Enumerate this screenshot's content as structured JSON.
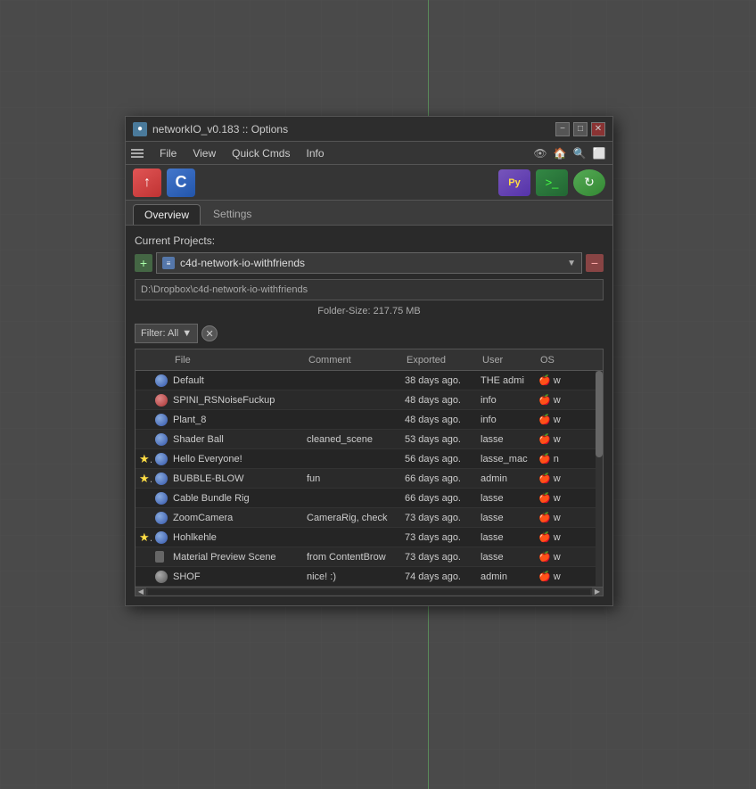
{
  "background": {
    "color": "#4a4a4a"
  },
  "window": {
    "title": "networkIO_v0.183 :: Options",
    "icon": "●",
    "min_label": "−",
    "max_label": "□",
    "close_label": "✕"
  },
  "menu": {
    "hamburger_label": "≡",
    "items": [
      "File",
      "View",
      "Quick Cmds",
      "Info"
    ],
    "icons": [
      "👁",
      "🏠",
      "🔍",
      "⬜"
    ]
  },
  "toolbar": {
    "btn_upload": "↑",
    "btn_c": "C",
    "btn_py": "Py",
    "btn_terminal": ">_",
    "btn_sync": "↻"
  },
  "tabs": {
    "items": [
      {
        "label": "Overview",
        "active": true
      },
      {
        "label": "Settings",
        "active": false
      }
    ]
  },
  "content": {
    "current_projects_label": "Current Projects:",
    "project_name": "c4d-network-io-withfriends",
    "project_path": "D:\\Dropbox\\c4d-network-io-withfriends",
    "folder_size_label": "Folder-Size: 217.75 MB",
    "filter_label": "Filter: All",
    "table": {
      "columns": [
        "",
        "",
        "File",
        "Comment",
        "Exported",
        "User",
        "OS"
      ],
      "rows": [
        {
          "flag": "",
          "type": "sphere",
          "file": "Default",
          "comment": "",
          "exported": "38 days ago.",
          "user": "THE admi",
          "os": "🍎 w"
        },
        {
          "flag": "",
          "type": "sphere-red",
          "file": "SPINI_RSNoiseFuckup",
          "comment": "",
          "exported": "48 days ago.",
          "user": "info",
          "os": "🍎 w"
        },
        {
          "flag": "",
          "type": "sphere",
          "file": "Plant_8",
          "comment": "",
          "exported": "48 days ago.",
          "user": "info",
          "os": "🍎 w"
        },
        {
          "flag": "",
          "type": "sphere",
          "file": "Shader Ball",
          "comment": "cleaned_scene",
          "exported": "53 days ago.",
          "user": "lasse",
          "os": "🍎 w"
        },
        {
          "flag": "★",
          "type": "sphere",
          "file": "Hello Everyone!",
          "comment": "",
          "exported": "56 days ago.",
          "user": "lasse_mac",
          "os": "🍎 n"
        },
        {
          "flag": "★",
          "type": "sphere",
          "file": "BUBBLE-BLOW",
          "comment": "fun",
          "exported": "66 days ago.",
          "user": "admin",
          "os": "🍎 w"
        },
        {
          "flag": "",
          "type": "sphere",
          "file": "Cable Bundle Rig",
          "comment": "",
          "exported": "66 days ago.",
          "user": "lasse",
          "os": "🍎 w"
        },
        {
          "flag": "",
          "type": "sphere",
          "file": "ZoomCamera",
          "comment": "CameraRig, check",
          "exported": "73 days ago.",
          "user": "lasse",
          "os": "🍎 w"
        },
        {
          "flag": "★",
          "type": "sphere",
          "file": "Hohlkehle",
          "comment": "",
          "exported": "73 days ago.",
          "user": "lasse",
          "os": "🍎 w"
        },
        {
          "flag": "",
          "type": "file",
          "file": "Material Preview Scene",
          "comment": "from ContentBrow",
          "exported": "73 days ago.",
          "user": "lasse",
          "os": "🍎 w"
        },
        {
          "flag": "",
          "type": "sphere-dark",
          "file": "SHOF",
          "comment": "nice! :)",
          "exported": "74 days ago.",
          "user": "admin",
          "os": "🍎 w"
        }
      ]
    }
  }
}
